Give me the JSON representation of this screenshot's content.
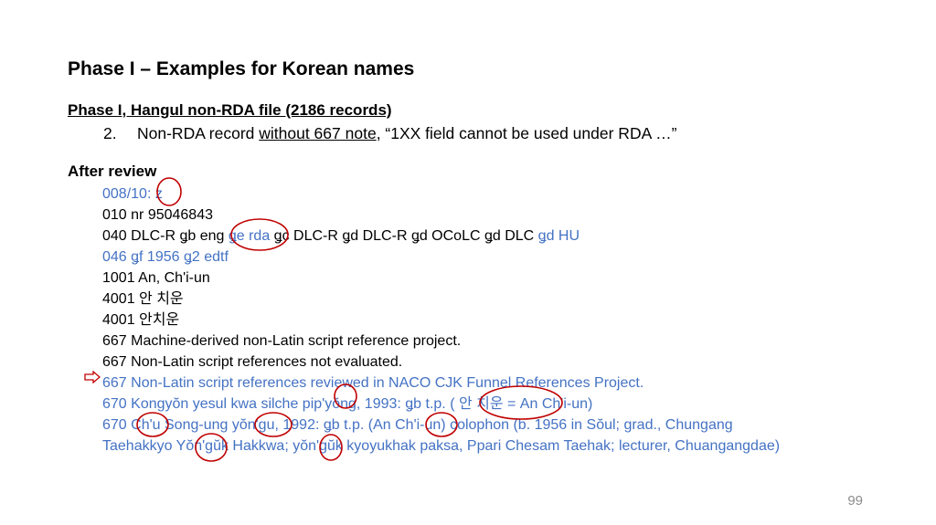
{
  "title": "Phase I – Examples for Korean names",
  "subheading": "Phase I,  Hangul non-RDA file (2186 records)",
  "item": {
    "number": "2.",
    "text_before": "Non-RDA record ",
    "underlined": "without 667 note",
    "text_after": ", “1XX field cannot be used under RDA …”"
  },
  "after_review_label": "After review",
  "record": {
    "l1": "008/10: z",
    "l2": "010  nr 95046843",
    "l3a": "040  DLC-R ǥb eng ",
    "l3b": "ǥe rda",
    "l3c": " ǥc DLC-R ǥd DLC-R ǥd OCoLC ǥd DLC ",
    "l3d": "ǥd HU",
    "l4": "046  ǥf 1956 ǥ2 edtf",
    "l5": "1001 An, Ch'i-un",
    "l6": "4001  안 치운",
    "l7": "4001  안치운",
    "l8": "667  Machine-derived non-Latin script reference project.",
    "l9": "667  Non-Latin script references not evaluated.",
    "l10": "667  Non-Latin script references reviewed in NACO CJK Funnel References Project.",
    "l11": "670  Kongyŏn yesul kwa silche pip'yŏng, 1993: ǥb t.p. ( 안 치운 = An Ch'i-un)",
    "l12": "670  Ch'u Song-ung yŏn'gu, 1992: ǥb t.p. (An Ch'i-un) colophon (b. 1956 in Sŏul; grad., Chungang",
    "l13": "Taehakkyo Yŏn'gŭk Hakkwa; yŏn'gŭk kyoyukhak paksa, Ppari Chesam Taehak; lecturer, Chuangangdae)"
  },
  "page_number": "99",
  "colors": {
    "blue_text": "#4472c4",
    "circle": "#c00000",
    "page_number": "#8c8c8c"
  }
}
